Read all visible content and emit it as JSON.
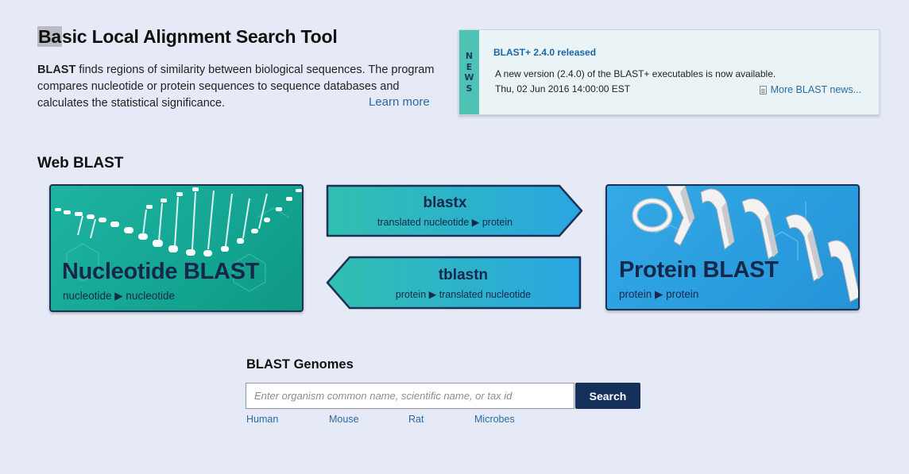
{
  "header": {
    "title_highlight": "Ba",
    "title_rest": "sic Local Alignment Search Tool",
    "intro_bold": "BLAST",
    "intro_text": " finds regions of similarity between biological sequences. The program compares nucleotide or protein sequences to sequence databases and calculates the statistical significance.",
    "learn_more": "Learn more"
  },
  "news": {
    "tab_letters": [
      "N",
      "E",
      "W",
      "S"
    ],
    "headline": "BLAST+ 2.4.0 released",
    "body": "A new version (2.4.0) of the BLAST+ executables is now available.",
    "date": "Thu, 02 Jun 2016 14:00:00 EST",
    "more_link": "More BLAST news..."
  },
  "web_blast": {
    "section_title": "Web BLAST",
    "nucleotide": {
      "title": "Nucleotide BLAST",
      "subtitle": "nucleotide ▶ nucleotide",
      "color": "#13a591"
    },
    "blastx": {
      "title": "blastx",
      "subtitle": "translated nucleotide ▶ protein"
    },
    "tblastn": {
      "title": "tblastn",
      "subtitle": "protein ▶ translated nucleotide"
    },
    "protein": {
      "title": "Protein BLAST",
      "subtitle": "protein ▶ protein",
      "color": "#2a9ddf"
    },
    "card_border_color": "#1c3155"
  },
  "genomes": {
    "title": "BLAST Genomes",
    "placeholder": "Enter organism common name, scientific name, or tax id",
    "search_label": "Search",
    "links": [
      "Human",
      "Mouse",
      "Rat",
      "Microbes"
    ]
  }
}
